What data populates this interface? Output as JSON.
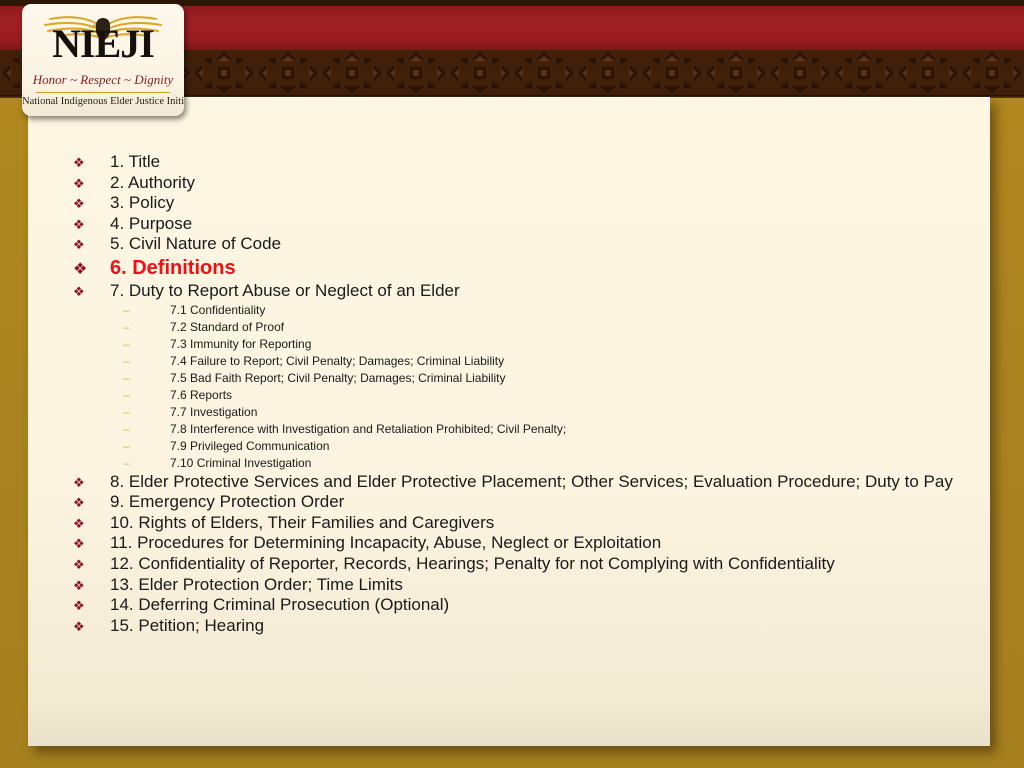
{
  "theme": {
    "background_gold": "#ad8521",
    "banner_red": "#9a1d20",
    "banner_brown": "#41200a",
    "card_cream": "#fdf6e2",
    "bullet_dark_red": "#8c1124",
    "accent_red": "#ef1016",
    "subbullet_gold": "#d9b84a"
  },
  "logo": {
    "name": "NIEJI",
    "wordmark": "NIEJI",
    "motto": "Honor ~ Respect ~ Dignity",
    "subtitle": "National Indigenous Elder Justice Initiative",
    "eagle_icon": "eagle-icon"
  },
  "outline": {
    "items": [
      {
        "level": 1,
        "bullet": "❖",
        "label": "1. Title",
        "accent": false
      },
      {
        "level": 1,
        "bullet": "❖",
        "label": "2. Authority",
        "accent": false
      },
      {
        "level": 1,
        "bullet": "❖",
        "label": "3. Policy",
        "accent": false
      },
      {
        "level": 1,
        "bullet": "❖",
        "label": "4. Purpose",
        "accent": false
      },
      {
        "level": 1,
        "bullet": "❖",
        "label": "5. Civil Nature of Code",
        "accent": false
      },
      {
        "level": 1,
        "bullet": "❖",
        "label": "6. Definitions",
        "accent": true
      },
      {
        "level": 1,
        "bullet": "❖",
        "label": "7. Duty to Report Abuse or Neglect of an Elder",
        "accent": false
      },
      {
        "level": 2,
        "bullet": "–",
        "label": "7.1 Confidentiality",
        "accent": false
      },
      {
        "level": 2,
        "bullet": "–",
        "label": "7.2 Standard of Proof",
        "accent": false
      },
      {
        "level": 2,
        "bullet": "–",
        "label": "7.3 Immunity for Reporting",
        "accent": false
      },
      {
        "level": 2,
        "bullet": "–",
        "label": "7.4 Failure to Report; Civil Penalty; Damages; Criminal Liability",
        "accent": false
      },
      {
        "level": 2,
        "bullet": "–",
        "label": "7.5 Bad Faith Report; Civil Penalty; Damages; Criminal Liability",
        "accent": false
      },
      {
        "level": 2,
        "bullet": "–",
        "label": "7.6 Reports",
        "accent": false
      },
      {
        "level": 2,
        "bullet": "–",
        "label": "7.7 Investigation",
        "accent": false
      },
      {
        "level": 2,
        "bullet": "–",
        "label": "7.8 Interference with Investigation and Retaliation Prohibited; Civil Penalty;",
        "accent": false
      },
      {
        "level": 2,
        "bullet": "–",
        "label": "7.9 Privileged Communication",
        "accent": false
      },
      {
        "level": 2,
        "bullet": "–",
        "label": "7.10 Criminal Investigation",
        "accent": false
      },
      {
        "level": 1,
        "bullet": "❖",
        "label": "8. Elder Protective Services and Elder Protective Placement; Other Services; Evaluation Procedure; Duty to Pay",
        "accent": false
      },
      {
        "level": 1,
        "bullet": "❖",
        "label": "9. Emergency Protection Order",
        "accent": false
      },
      {
        "level": 1,
        "bullet": "❖",
        "label": "10. Rights of Elders, Their Families and Caregivers",
        "accent": false
      },
      {
        "level": 1,
        "bullet": "❖",
        "label": "11. Procedures for Determining Incapacity, Abuse, Neglect or Exploitation",
        "accent": false
      },
      {
        "level": 1,
        "bullet": "❖",
        "label": "12. Confidentiality of Reporter, Records, Hearings; Penalty for not Complying with Confidentiality",
        "accent": false
      },
      {
        "level": 1,
        "bullet": "❖",
        "label": "13. Elder Protection Order; Time Limits",
        "accent": false
      },
      {
        "level": 1,
        "bullet": "❖",
        "label": "14. Deferring Criminal Prosecution (Optional)",
        "accent": false
      },
      {
        "level": 1,
        "bullet": "❖",
        "label": "15. Petition; Hearing",
        "accent": false
      }
    ]
  }
}
